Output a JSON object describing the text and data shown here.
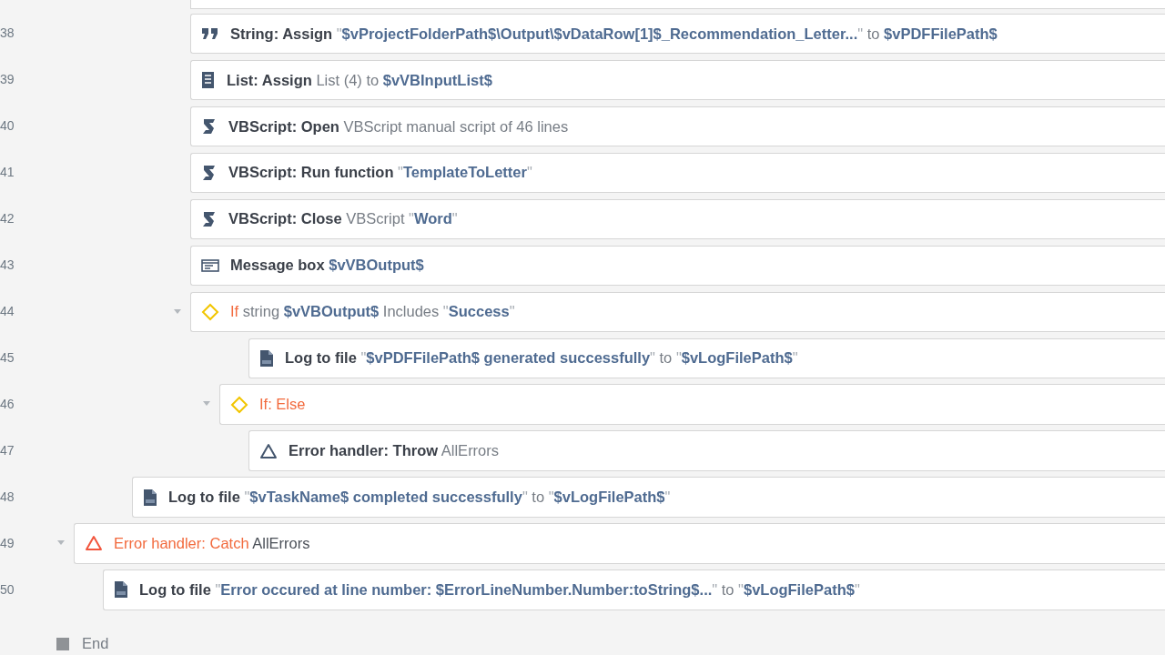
{
  "steps": [
    {
      "children": [
        {
          "children": [
            {
              "children": [
                {
                  "children": [
                    {
                      "kind": "partial"
                    },
                    {
                      "line": "38",
                      "kind": "quote",
                      "segments": [
                        {
                          "kind": "action",
                          "t": "String: Assign"
                        },
                        {
                          "kind": "quote",
                          "t": " \""
                        },
                        {
                          "kind": "value",
                          "t": "$vProjectFolderPath$\\Output\\$vDataRow[1]$_Recommendation_Letter..."
                        },
                        {
                          "kind": "quote",
                          "t": "\""
                        },
                        {
                          "kind": "text",
                          "t": " to "
                        },
                        {
                          "kind": "value",
                          "t": "$vPDFFilePath$"
                        }
                      ]
                    },
                    {
                      "line": "39",
                      "kind": "list",
                      "segments": [
                        {
                          "kind": "action",
                          "t": "List: Assign"
                        },
                        {
                          "kind": "text",
                          "t": " List (4) to "
                        },
                        {
                          "kind": "value",
                          "t": "$vVBInputList$"
                        }
                      ]
                    },
                    {
                      "line": "40",
                      "kind": "script",
                      "segments": [
                        {
                          "kind": "action",
                          "t": "VBScript: Open"
                        },
                        {
                          "kind": "text",
                          "t": " VBScript manual script of 46 lines"
                        }
                      ]
                    },
                    {
                      "line": "41",
                      "kind": "script",
                      "segments": [
                        {
                          "kind": "action",
                          "t": "VBScript: Run function"
                        },
                        {
                          "kind": "quote",
                          "t": " \""
                        },
                        {
                          "kind": "value",
                          "t": "TemplateToLetter"
                        },
                        {
                          "kind": "quote",
                          "t": "\""
                        }
                      ]
                    },
                    {
                      "line": "42",
                      "kind": "script",
                      "segments": [
                        {
                          "kind": "action",
                          "t": "VBScript: Close"
                        },
                        {
                          "kind": "text",
                          "t": " VBScript "
                        },
                        {
                          "kind": "quote",
                          "t": "\""
                        },
                        {
                          "kind": "value",
                          "t": "Word"
                        },
                        {
                          "kind": "quote",
                          "t": "\""
                        }
                      ]
                    },
                    {
                      "line": "43",
                      "kind": "message",
                      "segments": [
                        {
                          "kind": "action",
                          "t": "Message box"
                        },
                        {
                          "kind": "value",
                          "t": " $vVBOutput$"
                        }
                      ]
                    },
                    {
                      "line": "44",
                      "kind": "condition",
                      "expanded": true,
                      "segments": [
                        {
                          "kind": "alert",
                          "t": "If"
                        },
                        {
                          "kind": "text",
                          "t": " string "
                        },
                        {
                          "kind": "value",
                          "t": "$vVBOutput$"
                        },
                        {
                          "kind": "text",
                          "t": " Includes "
                        },
                        {
                          "kind": "quote",
                          "t": "\""
                        },
                        {
                          "kind": "value",
                          "t": "Success"
                        },
                        {
                          "kind": "quote",
                          "t": "\""
                        }
                      ],
                      "children": [
                        {
                          "children": [
                            {
                              "line": "45",
                              "kind": "log",
                              "segments": [
                                {
                                  "kind": "action",
                                  "t": "Log to file"
                                },
                                {
                                  "kind": "quote",
                                  "t": " \""
                                },
                                {
                                  "kind": "value",
                                  "t": "$vPDFFilePath$ generated successfully"
                                },
                                {
                                  "kind": "quote",
                                  "t": "\""
                                },
                                {
                                  "kind": "text",
                                  "t": " to "
                                },
                                {
                                  "kind": "quote",
                                  "t": "\""
                                },
                                {
                                  "kind": "value",
                                  "t": "$vLogFilePath$"
                                },
                                {
                                  "kind": "quote",
                                  "t": "\""
                                }
                              ]
                            }
                          ]
                        }
                      ]
                    },
                    {
                      "children": [
                        {
                          "line": "46",
                          "kind": "condition",
                          "expanded": true,
                          "segments": [
                            {
                              "kind": "alert",
                              "t": "If: Else"
                            }
                          ],
                          "children": [
                            {
                              "line": "47",
                              "kind": "throw",
                              "segments": [
                                {
                                  "kind": "action",
                                  "t": "Error handler: Throw"
                                },
                                {
                                  "kind": "text",
                                  "t": " AllErrors"
                                }
                              ]
                            }
                          ]
                        }
                      ]
                    }
                  ]
                }
              ]
            },
            {
              "line": "48",
              "kind": "log",
              "segments": [
                {
                  "kind": "action",
                  "t": "Log to file"
                },
                {
                  "kind": "quote",
                  "t": " \""
                },
                {
                  "kind": "value",
                  "t": "$vTaskName$ completed successfully"
                },
                {
                  "kind": "quote",
                  "t": "\""
                },
                {
                  "kind": "text",
                  "t": " to "
                },
                {
                  "kind": "quote",
                  "t": "\""
                },
                {
                  "kind": "value",
                  "t": "$vLogFilePath$"
                },
                {
                  "kind": "quote",
                  "t": "\""
                }
              ]
            }
          ]
        }
      ]
    },
    {
      "line": "49",
      "kind": "catch",
      "expanded": true,
      "segments": [
        {
          "kind": "alert",
          "t": "Error handler: Catch"
        },
        {
          "kind": "plain",
          "t": " AllErrors"
        }
      ],
      "children": [
        {
          "line": "50",
          "kind": "log",
          "segments": [
            {
              "kind": "action",
              "t": "Log to file"
            },
            {
              "kind": "quote",
              "t": " \""
            },
            {
              "kind": "value",
              "t": "Error occured at line number: $ErrorLineNumber.Number:toString$..."
            },
            {
              "kind": "quote",
              "t": "\""
            },
            {
              "kind": "text",
              "t": " to "
            },
            {
              "kind": "quote",
              "t": "\""
            },
            {
              "kind": "value",
              "t": "$vLogFilePath$"
            },
            {
              "kind": "quote",
              "t": "\""
            }
          ]
        }
      ]
    }
  ],
  "end": {
    "label": "End"
  }
}
